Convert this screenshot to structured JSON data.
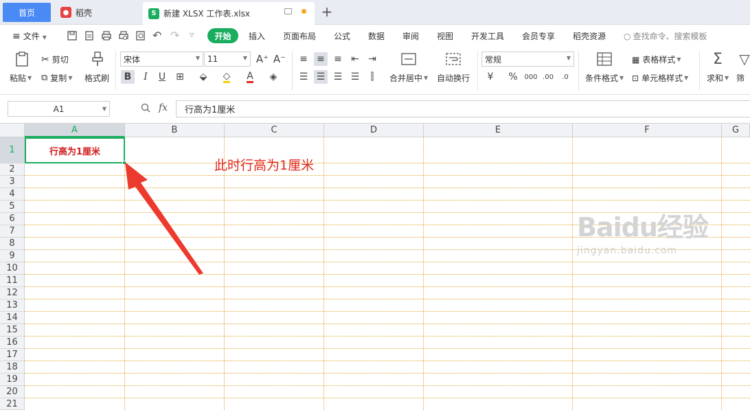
{
  "tabs": {
    "home": "首页",
    "daoke": "稻壳",
    "file": "新建 XLSX 工作表.xlsx"
  },
  "menu": {
    "file": "文件",
    "items": [
      "开始",
      "插入",
      "页面布局",
      "公式",
      "数据",
      "审阅",
      "视图",
      "开发工具",
      "会员专享",
      "稻壳资源"
    ],
    "search": "查找命令、搜索模板"
  },
  "ribbon": {
    "paste": "粘贴",
    "cut": "剪切",
    "copy": "复制",
    "format_painter": "格式刷",
    "font_name": "宋体",
    "font_size": "11",
    "merge": "合并居中",
    "wrap": "自动换行",
    "number_format": "常规",
    "conditional_format": "条件格式",
    "table_style": "表格样式",
    "cell_style": "单元格样式",
    "sum": "求和",
    "filter": "筛"
  },
  "formula_bar": {
    "name_box": "A1",
    "fx": "fx",
    "content": "行高为1厘米"
  },
  "sheet": {
    "columns": [
      "A",
      "B",
      "C",
      "D",
      "E",
      "F",
      "G"
    ],
    "rows": [
      "1",
      "2",
      "3",
      "4",
      "5",
      "6",
      "7",
      "8",
      "9",
      "10",
      "11",
      "12",
      "13",
      "14",
      "15",
      "16",
      "17",
      "18",
      "19",
      "20",
      "21"
    ],
    "a1_value": "行高为1厘米",
    "annotation": "此时行高为1厘米"
  },
  "watermark": {
    "main": "Baidu经验",
    "sub": "jingyan.baidu.com"
  },
  "colors": {
    "accent_green": "#1aad5f",
    "home_tab": "#4a8af4",
    "annotation_red": "#e0281e",
    "gridline": "#e3a72f"
  }
}
